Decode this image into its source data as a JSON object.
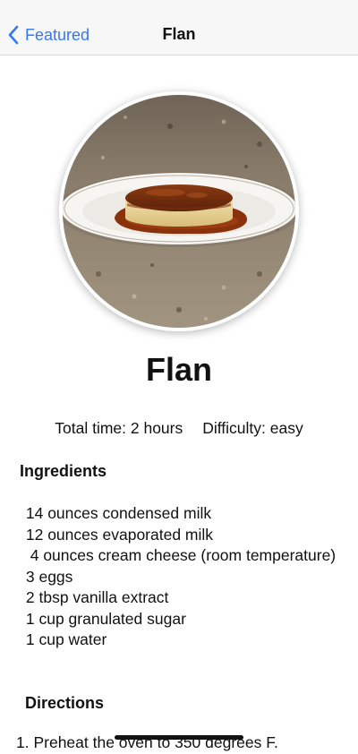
{
  "nav": {
    "back_label": "Featured",
    "title": "Flan"
  },
  "recipe": {
    "title": "Flan",
    "image_alt": "Flan with caramel sauce on a white plate",
    "total_time": "Total time: 2 hours",
    "difficulty": "Difficulty: easy",
    "ingredients_heading": "Ingredients",
    "ingredients": [
      " 14 ounces condensed milk",
      " 12 ounces evaporated milk",
      "  4 ounces cream cheese (room temperature)",
      " 3 eggs",
      " 2 tbsp vanilla extract",
      " 1 cup granulated sugar",
      " 1 cup water"
    ],
    "directions_heading": "Directions",
    "directions": [
      "1. Preheat the oven to 350 degrees F."
    ]
  },
  "colors": {
    "accent": "#3478f6",
    "caramel": "#7a2f0d",
    "custard": "#ecd79a"
  },
  "icons": {
    "back": "chevron-left-icon"
  }
}
